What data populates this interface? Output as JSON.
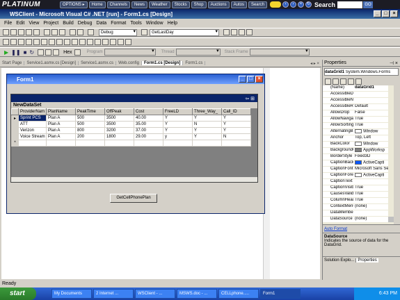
{
  "banner": {
    "logo": "PLATINUM",
    "options": "OPTIONS ▸",
    "links": [
      "Home",
      "Channels",
      "News",
      "Weather",
      "Stocks",
      "Shop",
      "Auctions",
      "Autos",
      "Search"
    ],
    "search_label": "Search",
    "go": "GO"
  },
  "window": {
    "title": "WSClient - Microsoft Visual C# .NET [run] - Form1.cs [Design]"
  },
  "menu": [
    "File",
    "Edit",
    "View",
    "Project",
    "Build",
    "Debug",
    "Data",
    "Format",
    "Tools",
    "Window",
    "Help"
  ],
  "toolbar": {
    "config": "Debug",
    "function": "GetLastDay",
    "hex": "Hex",
    "program_label": "Program",
    "thread_label": "Thread",
    "stack_label": "Stack Frame"
  },
  "tabs": [
    "Start Page",
    "Service1.asmx.cs [Design]",
    "Service1.asmx.cs",
    "Web.config",
    "Form1.cs [Design]",
    "Form1.cs"
  ],
  "form": {
    "title": "Form1",
    "caption": "NewDataSet",
    "button": "GetCellPhonePlan"
  },
  "grid": {
    "columns": [
      "ProviderNam",
      "PlanName",
      "PeakTime",
      "OffPeak",
      "Cost",
      "FreeLD",
      "Three_Way_",
      "Call_ID"
    ],
    "rows": [
      [
        "Sprint PCS",
        "Plan A",
        "500",
        "3500",
        "40.00",
        "Y",
        "Y",
        "Y"
      ],
      [
        "ATT",
        "Plan A",
        "500",
        "3500",
        "35.00",
        "Y",
        "N",
        "Y"
      ],
      [
        "Verizon",
        "Plan A",
        "800",
        "3200",
        "37.00",
        "Y",
        "Y",
        "Y"
      ],
      [
        "Voice Stream",
        "Plan A",
        "200",
        "1800",
        "29.00",
        "y",
        "Y",
        "N"
      ]
    ]
  },
  "properties": {
    "title": "Properties",
    "object": "dataGrid1",
    "type": "System.Windows.Forms",
    "rows": [
      [
        "(Name)",
        "dataGrid1",
        ""
      ],
      [
        "AccessibleDescri",
        "",
        ""
      ],
      [
        "AccessibleName",
        "",
        ""
      ],
      [
        "AccessibleRole",
        "Default",
        ""
      ],
      [
        "AllowDrop",
        "False",
        ""
      ],
      [
        "AllowNavigation",
        "True",
        ""
      ],
      [
        "AllowSorting",
        "True",
        ""
      ],
      [
        "AlternatingBack",
        "Window",
        "#ffffff"
      ],
      [
        "Anchor",
        "Top, Left",
        ""
      ],
      [
        "BackColor",
        "Window",
        "#ffffff"
      ],
      [
        "BackgroundColo",
        "AppWorksp",
        "#808080"
      ],
      [
        "BorderStyle",
        "Fixed3D",
        ""
      ],
      [
        "CaptionBackColo",
        "ActiveCapti",
        "#0a58ff"
      ],
      [
        "CaptionFont",
        "Microsoft Sans Se",
        ""
      ],
      [
        "CaptionForeColo",
        "ActiveCapti",
        "#ffffff"
      ],
      [
        "CaptionText",
        "",
        ""
      ],
      [
        "CaptionVisible",
        "True",
        ""
      ],
      [
        "CausesValidatio",
        "True",
        ""
      ],
      [
        "ColumnHeaders",
        "True",
        ""
      ],
      [
        "ContextMenu",
        "(none)",
        ""
      ],
      [
        "DataMember",
        "",
        ""
      ],
      [
        "DataSource",
        "(none)",
        ""
      ]
    ],
    "link": "Auto Format",
    "desc_title": "DataSource",
    "desc": "Indicates the source of data for the DataGrid.",
    "tab1": "Solution Explo...",
    "tab2": "Properties"
  },
  "status": "Ready",
  "taskbar": {
    "start": "start",
    "items": [
      "My Documents",
      "2 Internet ...",
      "WSClient - ...",
      "MSWS.doc - ...",
      "CELLphone.....",
      "Form1"
    ],
    "time": "6:43 PM"
  }
}
